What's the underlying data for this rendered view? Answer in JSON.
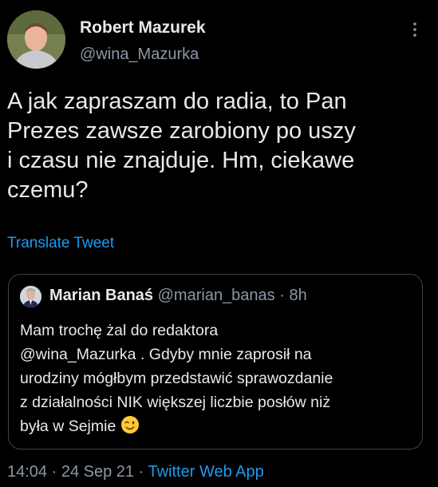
{
  "author": {
    "name": "Robert Mazurek",
    "handle": "@wina_Mazurka"
  },
  "tweet": {
    "lines": [
      "A jak zapraszam do radia, to Pan",
      "Prezes zawsze zarobiony po uszy",
      "i czasu nie znajduje. Hm, ciekawe",
      "czemu?"
    ],
    "translate_label": "Translate Tweet"
  },
  "quoted": {
    "name": "Marian Banaś",
    "handle": "@marian_banas",
    "separator": "·",
    "time": "8h",
    "lines": [
      "Mam trochę żal do redaktora",
      "@wina_Mazurka . Gdyby mnie zaprosił na",
      "urodziny mógłbym przedstawić sprawozdanie",
      "z działalności NIK większej liczbie posłów niż",
      "była w Sejmie"
    ],
    "emoji": "winking-face"
  },
  "meta": {
    "time": "14:04",
    "separator": "·",
    "date": "24 Sep 21",
    "source": "Twitter Web App"
  },
  "icons": {
    "more": "more-vertical-icon",
    "emoji": "winking-face-emoji-icon"
  },
  "colors": {
    "background": "#000000",
    "primary_text": "#e7e9ea",
    "secondary_text": "#8b98a5",
    "link": "#1d9bf0",
    "border": "#38444d"
  }
}
